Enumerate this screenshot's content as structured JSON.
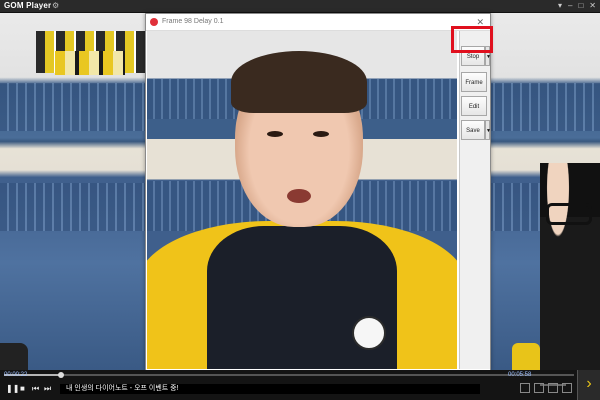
{
  "app": {
    "title": "GOM Player"
  },
  "popup": {
    "title": "Frame 98 Delay 0.1",
    "buttons": {
      "stop": "Stop",
      "frame": "Frame",
      "edit": "Edit",
      "save": "Save"
    }
  },
  "player": {
    "time_current": "00:00:22",
    "time_total": "00:05:58",
    "progress": 0.1,
    "subtitle": "내 인생의 다이어노트 - 오프 이벤트 중!"
  },
  "accent": {
    "highlight": "#e0101e",
    "brand": "#e8c419"
  }
}
